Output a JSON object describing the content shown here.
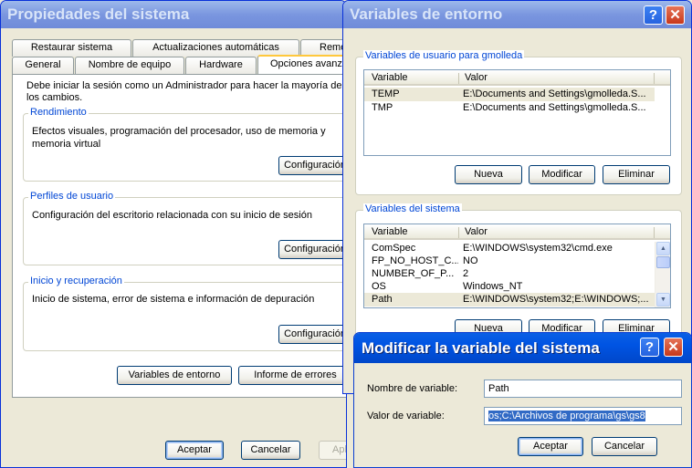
{
  "props": {
    "title": "Propiedades del sistema",
    "tabs_row1": [
      "Restaurar sistema",
      "Actualizaciones automáticas",
      "Remo"
    ],
    "tabs_row2": [
      "General",
      "Nombre de equipo",
      "Hardware",
      "Opciones avanza"
    ],
    "intro": "Debe iniciar la sesión como un Administrador para hacer la mayoría de los cambios.",
    "groups": [
      {
        "title": "Rendimiento",
        "text": "Efectos visuales, programación del procesador, uso de memoria y memoria virtual",
        "button": "Configuración"
      },
      {
        "title": "Perfiles de usuario",
        "text": "Configuración del escritorio relacionada con su inicio de sesión",
        "button": "Configuración"
      },
      {
        "title": "Inicio y recuperación",
        "text": "Inicio de sistema, error de sistema e información de depuración",
        "button": "Configuración"
      }
    ],
    "env_button": "Variables de entorno",
    "errors_button": "Informe de errores",
    "ok": "Aceptar",
    "cancel": "Cancelar",
    "apply": "Aplic"
  },
  "env": {
    "title": "Variables de entorno",
    "user_group_title": "Variables de usuario para gmolleda",
    "col_variable": "Variable",
    "col_value": "Valor",
    "user_vars": [
      {
        "name": "TEMP",
        "value": "E:\\Documents and Settings\\gmolleda.S..."
      },
      {
        "name": "TMP",
        "value": "E:\\Documents and Settings\\gmolleda.S..."
      }
    ],
    "system_group_title": "Variables del sistema",
    "system_vars": [
      {
        "name": "ComSpec",
        "value": "E:\\WINDOWS\\system32\\cmd.exe"
      },
      {
        "name": "FP_NO_HOST_C...",
        "value": "NO"
      },
      {
        "name": "NUMBER_OF_P...",
        "value": "2"
      },
      {
        "name": "OS",
        "value": "Windows_NT"
      },
      {
        "name": "Path",
        "value": "E:\\WINDOWS\\system32;E:\\WINDOWS;..."
      }
    ],
    "new": "Nueva",
    "edit": "Modificar",
    "delete": "Eliminar"
  },
  "modify": {
    "title": "Modificar la variable del sistema",
    "name_label": "Nombre de variable:",
    "name_value": "Path",
    "value_label": "Valor de variable:",
    "value_value": "os;C:\\Archivos de programa\\gs\\gs8",
    "ok": "Aceptar",
    "cancel": "Cancelar"
  },
  "title_buttons": {
    "help": "?",
    "close": "✕"
  },
  "colors": {
    "titlebar": "#0054e3",
    "titlebar_inactive": "#7a96df",
    "dialog_bg": "#ece9d8",
    "group_title": "#0046d5",
    "selection": "#316ac5"
  }
}
